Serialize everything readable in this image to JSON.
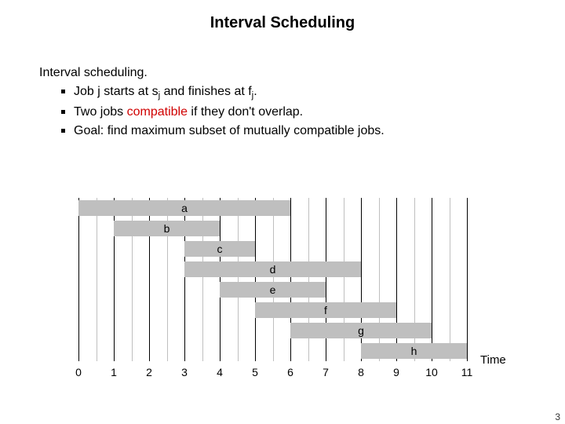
{
  "title": "Interval Scheduling",
  "lead": "Interval scheduling.",
  "bullets": {
    "b1_pre": "Job j starts at s",
    "b1_sub1": "j",
    "b1_mid": " and finishes at f",
    "b1_sub2": "j",
    "b1_post": ".",
    "b2_pre": "Two jobs ",
    "b2_red": "compatible",
    "b2_post": " if they don't overlap.",
    "b3": "Goal:  find maximum subset of mutually compatible jobs."
  },
  "axis_label": "Time",
  "page_number": "3",
  "chart_data": {
    "type": "bar",
    "title": "",
    "xlabel": "Time",
    "ylabel": "",
    "xlim": [
      0,
      11
    ],
    "grid_dark": [
      0,
      1,
      2,
      3,
      4,
      5,
      6,
      7,
      8,
      9,
      10,
      11
    ],
    "grid_light_half": true,
    "tick_labels": [
      "0",
      "1",
      "2",
      "3",
      "4",
      "5",
      "6",
      "7",
      "8",
      "9",
      "10",
      "11"
    ],
    "series": [
      {
        "name": "a",
        "values": [
          0,
          6
        ]
      },
      {
        "name": "b",
        "values": [
          1,
          4
        ]
      },
      {
        "name": "c",
        "values": [
          3,
          5
        ]
      },
      {
        "name": "d",
        "values": [
          3,
          8
        ]
      },
      {
        "name": "e",
        "values": [
          4,
          7
        ]
      },
      {
        "name": "f",
        "values": [
          5,
          9
        ]
      },
      {
        "name": "g",
        "values": [
          6,
          10
        ]
      },
      {
        "name": "h",
        "values": [
          8,
          11
        ]
      }
    ]
  }
}
